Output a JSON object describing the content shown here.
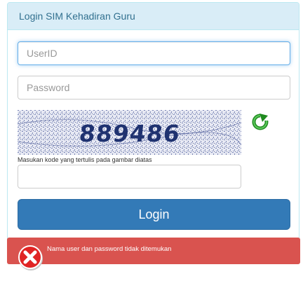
{
  "panel": {
    "title": "Login SIM Kehadiran Guru"
  },
  "form": {
    "userid_placeholder": "UserID",
    "password_placeholder": "Password",
    "captcha_code": "889486",
    "captcha_hint": "Masukan kode yang tertulis pada gambar diatas",
    "captcha_input_value": "",
    "login_label": "Login"
  },
  "alert": {
    "message": "Nama user dan password tidak ditemukan"
  },
  "icons": {
    "refresh": "refresh-icon",
    "error": "error-icon"
  },
  "colors": {
    "heading_bg": "#d9edf7",
    "heading_text": "#31708f",
    "primary_button": "#337ab7",
    "alert_bg": "#d9534f",
    "refresh_green": "#2a9a2a"
  }
}
